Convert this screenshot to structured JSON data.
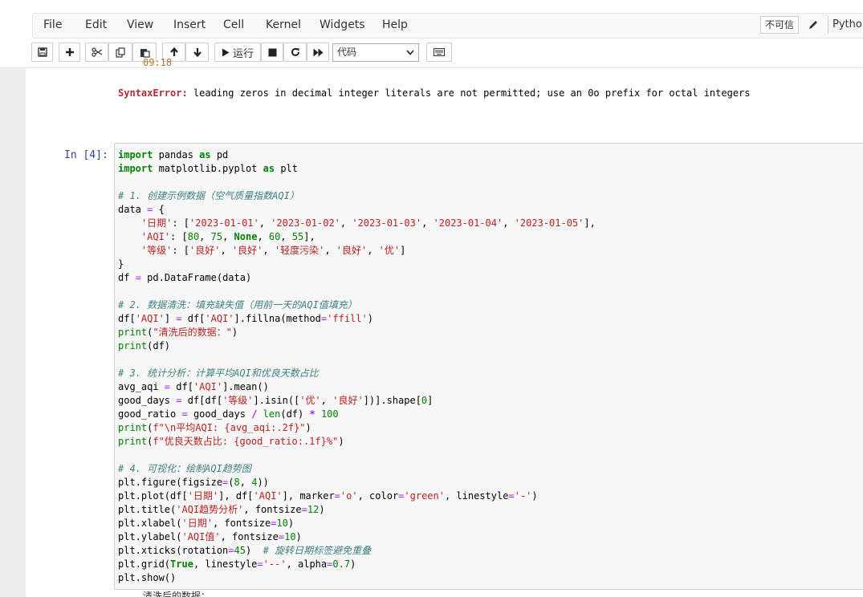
{
  "menu": {
    "items": [
      "File",
      "Edit",
      "View",
      "Insert",
      "Cell",
      "Kernel",
      "Widgets",
      "Help"
    ],
    "trust_label": "不可信",
    "kernel_label": "Python"
  },
  "toolbar": {
    "run_label": "运行",
    "cell_type_value": "代码"
  },
  "output_above": {
    "cutoff_text": "09:18",
    "error_name": "SyntaxError:",
    "error_message": " leading zeros in decimal integer literals are not permitted; use an 0o prefix for octal integers"
  },
  "cell": {
    "prompt": "In  [4]:",
    "code_lines": [
      "import pandas as pd",
      "import matplotlib.pyplot as plt",
      "",
      "# 1. 创建示例数据（空气质量指数AQI）",
      "data = {",
      "    '日期': ['2023-01-01', '2023-01-02', '2023-01-03', '2023-01-04', '2023-01-05'],",
      "    'AQI': [80, 75, None, 60, 55],",
      "    '等级': ['良好', '良好', '轻度污染', '良好', '优']",
      "}",
      "df = pd.DataFrame(data)",
      "",
      "# 2. 数据清洗：填充缺失值（用前一天的AQI值填充）",
      "df['AQI'] = df['AQI'].fillna(method='ffill')",
      "print(\"清洗后的数据：\")",
      "print(df)",
      "",
      "# 3. 统计分析：计算平均AQI和优良天数占比",
      "avg_aqi = df['AQI'].mean()",
      "good_days = df[df['等级'].isin(['优', '良好'])].shape[0]",
      "good_ratio = good_days / len(df) * 100",
      "print(f\"\\n平均AQI: {avg_aqi:.2f}\")",
      "print(f\"优良天数占比: {good_ratio:.1f}%\")",
      "",
      "# 4. 可视化：绘制AQI趋势图",
      "plt.figure(figsize=(8, 4))",
      "plt.plot(df['日期'], df['AQI'], marker='o', color='green', linestyle='-')",
      "plt.title('AQI趋势分析', fontsize=12)",
      "plt.xlabel('日期', fontsize=10)",
      "plt.ylabel('AQI值', fontsize=10)",
      "plt.xticks(rotation=45)  # 旋转日期标签避免重叠",
      "plt.grid(True, linestyle='--', alpha=0.7)",
      "plt.show()"
    ]
  },
  "output_below": {
    "cutoff_text": "清洗后的数据："
  },
  "colors": {
    "keyword": "#008000",
    "string": "#ba2121",
    "comment": "#408080",
    "operator": "#aa22ff",
    "prompt": "#303f9f",
    "error": "#b22b31"
  }
}
